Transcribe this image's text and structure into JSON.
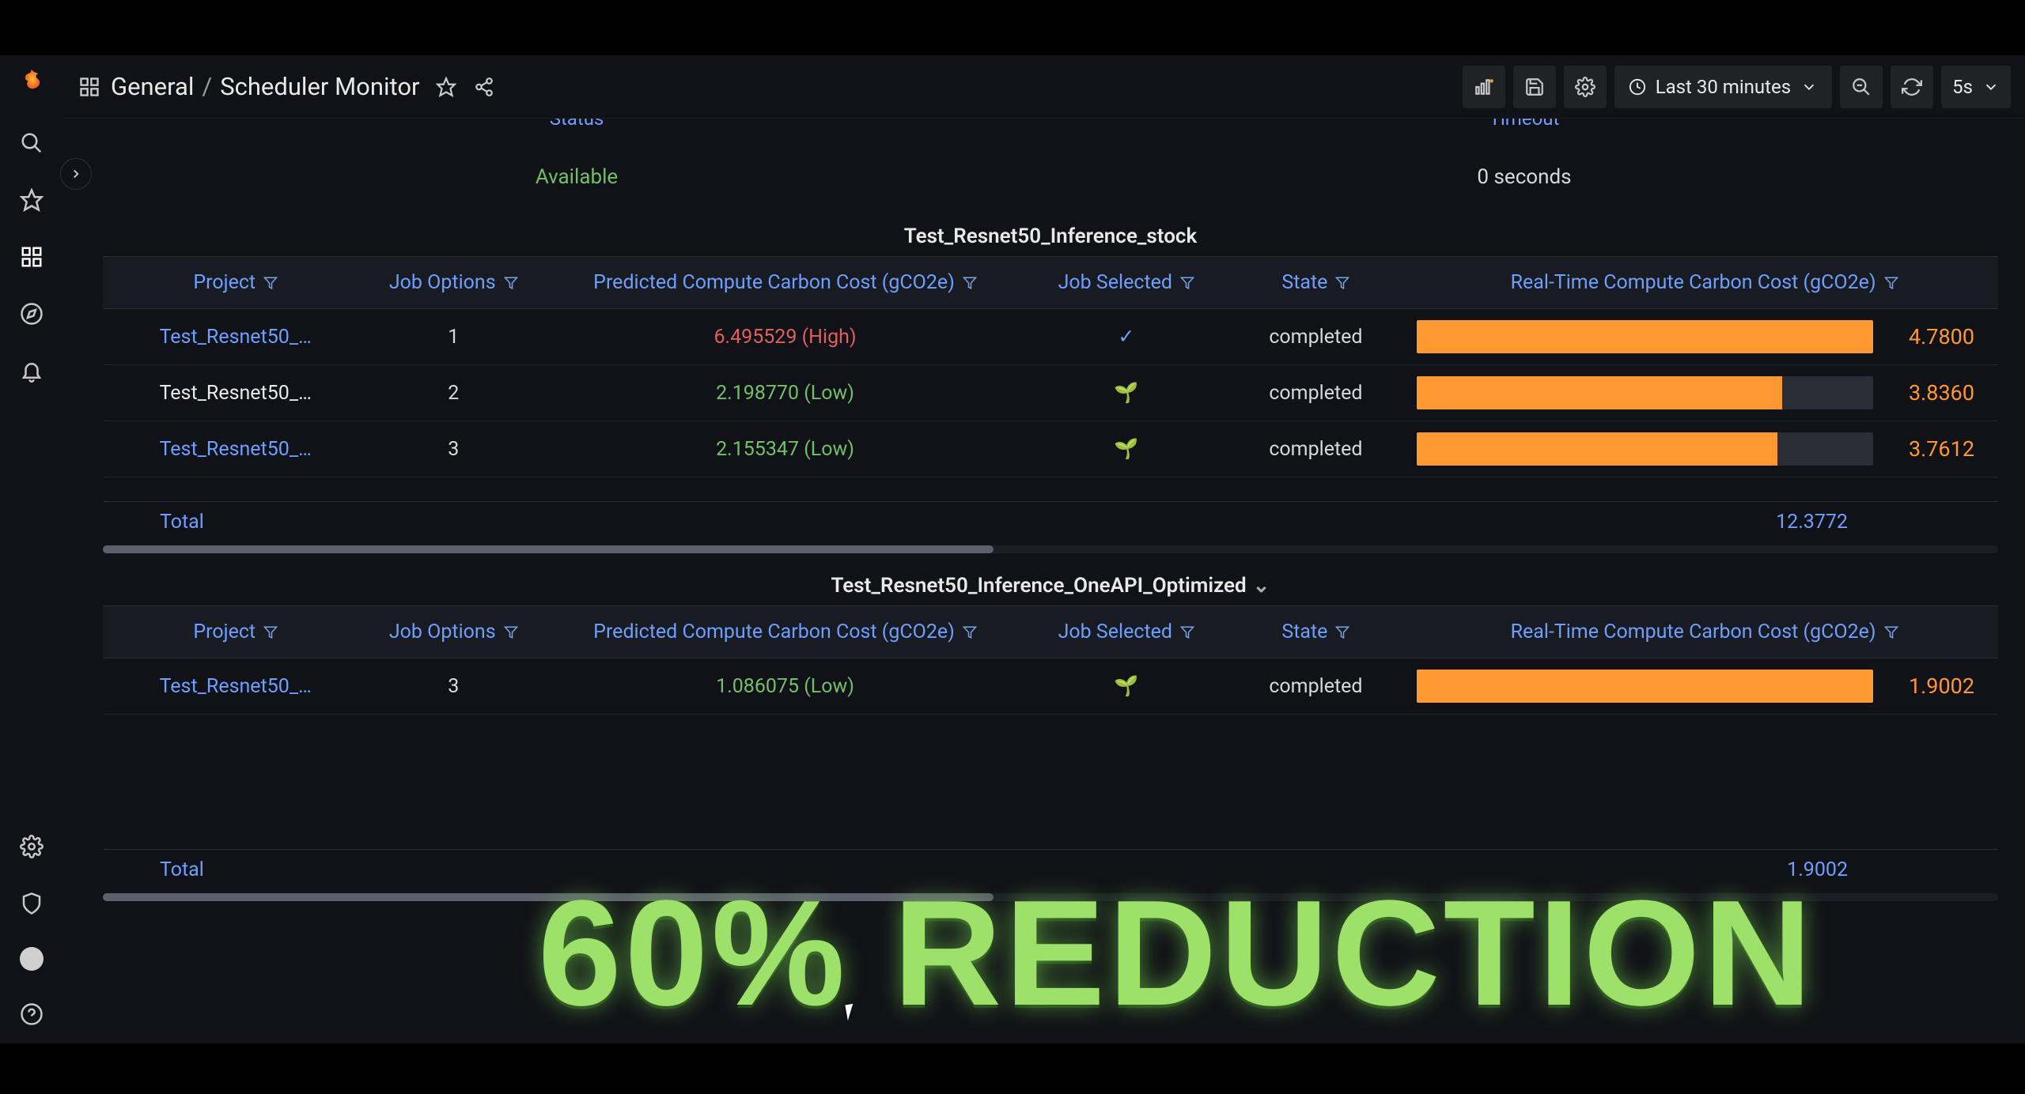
{
  "breadcrumb": {
    "folder": "General",
    "page": "Scheduler Monitor"
  },
  "toolbar": {
    "time_range": "Last 30 minutes",
    "refresh_interval": "5s"
  },
  "status_panel": {
    "header_left": "Status",
    "header_right": "Timeout",
    "value_left": "Available",
    "value_right": "0 seconds"
  },
  "columns": {
    "project": "Project",
    "job_options": "Job Options",
    "predicted": "Predicted Compute Carbon Cost (gCO2e)",
    "selected": "Job Selected",
    "state": "State",
    "realtime": "Real-Time Compute Carbon Cost (gCO2e)"
  },
  "panel1": {
    "title": "Test_Resnet50_Inference_stock",
    "rows": [
      {
        "project": "Test_Resnet50_…",
        "link": true,
        "opt": "1",
        "pred": "6.495529 (High)",
        "pred_class": "pred-high",
        "sel": "✓",
        "sel_class": "check",
        "state": "completed",
        "bar_pct": 100,
        "bar_val": "4.7800"
      },
      {
        "project": "Test_Resnet50_…",
        "link": false,
        "opt": "2",
        "pred": "2.198770 (Low)",
        "pred_class": "pred-low",
        "sel": "🌱",
        "sel_class": "seed",
        "state": "completed",
        "bar_pct": 80,
        "bar_val": "3.8360"
      },
      {
        "project": "Test_Resnet50_…",
        "link": true,
        "opt": "3",
        "pred": "2.155347 (Low)",
        "pred_class": "pred-low",
        "sel": "🌱",
        "sel_class": "seed",
        "state": "completed",
        "bar_pct": 79,
        "bar_val": "3.7612"
      }
    ],
    "total_label": "Total",
    "total_value": "12.3772",
    "scroll_thumb_pct": 47
  },
  "panel2": {
    "title": "Test_Resnet50_Inference_OneAPI_Optimized",
    "rows": [
      {
        "project": "Test_Resnet50_…",
        "link": true,
        "opt": "3",
        "pred": "1.086075 (Low)",
        "pred_class": "pred-low",
        "sel": "🌱",
        "sel_class": "seed",
        "state": "completed",
        "bar_pct": 100,
        "bar_val": "1.9002"
      }
    ],
    "total_label": "Total",
    "total_value": "1.9002",
    "scroll_thumb_pct": 47
  },
  "overlay": "60% REDUCTION"
}
